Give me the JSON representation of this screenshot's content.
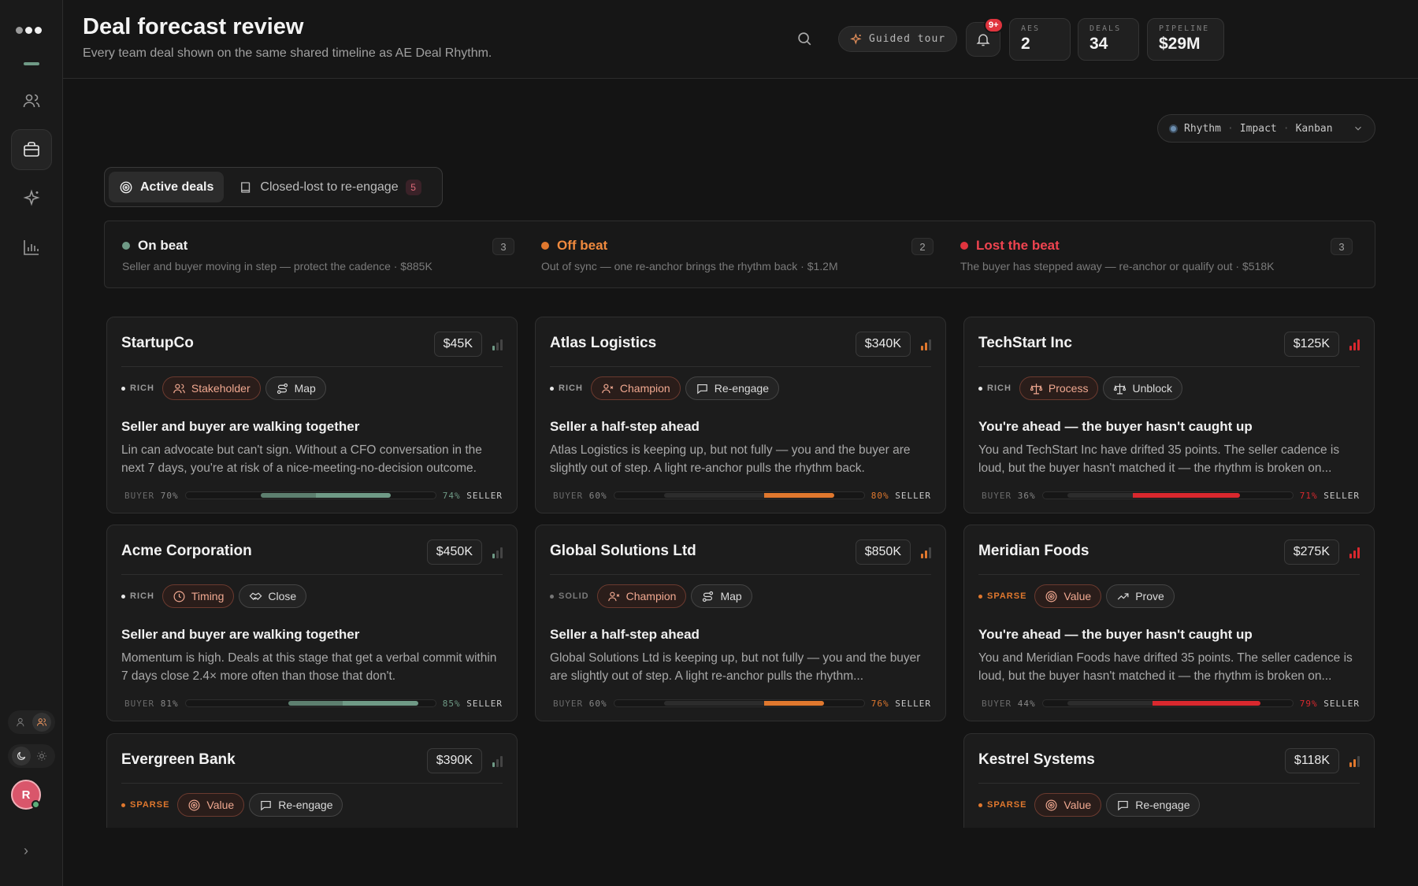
{
  "header": {
    "title": "Deal forecast review",
    "subtitle": "Every team deal shown on the same shared timeline as AE Deal Rhythm.",
    "guided_tour": "Guided tour",
    "notifications_badge": "9+",
    "stats": [
      {
        "label": "AES",
        "value": "2"
      },
      {
        "label": "DEALS",
        "value": "34"
      },
      {
        "label": "PIPELINE",
        "value": "$29M"
      }
    ]
  },
  "sidebar": {
    "avatar_initial": "R",
    "items": [
      {
        "icon": "users-icon",
        "active": false
      },
      {
        "icon": "briefcase-icon",
        "active": true
      },
      {
        "icon": "sparkle-icon",
        "active": false
      },
      {
        "icon": "bar-chart-icon",
        "active": false
      }
    ]
  },
  "view_switch": {
    "options": [
      "Rhythm",
      "Impact",
      "Kanban"
    ],
    "selected": "Rhythm"
  },
  "deal_tabs": {
    "active": "Active deals",
    "closed_lost": "Closed-lost to re-engage",
    "closed_lost_count": "5"
  },
  "beats": [
    {
      "title": "On beat",
      "desc": "Seller and buyer moving in step — protect the cadence · $885K",
      "count": "3",
      "color": "#6f9a86",
      "title_color": "#f0f0f0"
    },
    {
      "title": "Off beat",
      "desc": "Out of sync — one re-anchor brings the rhythm back · $1.2M",
      "count": "2",
      "color": "#e0782e",
      "title_color": "#f08a3e"
    },
    {
      "title": "Lost the beat",
      "desc": "The buyer has stepped away — re-anchor or qualify out · $518K",
      "count": "3",
      "color": "#e0343e",
      "title_color": "#f04450"
    }
  ],
  "colors": {
    "green": "#6f9a86",
    "orange": "#e0782e",
    "red": "#d9282e"
  },
  "cards": [
    {
      "name": "StartupCo",
      "amount": "$45K",
      "richness": "RICH",
      "tag1": "Stakeholder",
      "tag1_icon": "users-icon",
      "tag2": "Map",
      "tag2_icon": "route-icon",
      "headline": "Seller and buyer are walking together",
      "body": "Lin can advocate but can't sign. Without a CFO conversation in the next 7 days, you're at risk of a nice-meeting-no-decision outcome.",
      "buyer_pct": "70%",
      "seller_pct": "74%",
      "buyer": 70,
      "seller": 74,
      "status": "green"
    },
    {
      "name": "Atlas Logistics",
      "amount": "$340K",
      "richness": "RICH",
      "tag1": "Champion",
      "tag1_icon": "user-x-icon",
      "tag2": "Re-engage",
      "tag2_icon": "message-icon",
      "headline": "Seller a half-step ahead",
      "body": "Atlas Logistics is keeping up, but not fully — you and the buyer are slightly out of step. A light re-anchor pulls the rhythm back.",
      "buyer_pct": "60%",
      "seller_pct": "80%",
      "buyer": 60,
      "seller": 80,
      "status": "orange"
    },
    {
      "name": "TechStart Inc",
      "amount": "$125K",
      "richness": "RICH",
      "tag1": "Process",
      "tag1_icon": "scale-icon",
      "tag2": "Unblock",
      "tag2_icon": "scale-icon",
      "headline": "You're ahead — the buyer hasn't caught up",
      "body": "You and TechStart Inc have drifted 35 points. The seller cadence is loud, but the buyer hasn't matched it — the rhythm is broken on...",
      "buyer_pct": "36%",
      "seller_pct": "71%",
      "buyer": 36,
      "seller": 71,
      "status": "red"
    },
    {
      "name": "Acme Corporation",
      "amount": "$450K",
      "richness": "RICH",
      "tag1": "Timing",
      "tag1_icon": "clock-icon",
      "tag2": "Close",
      "tag2_icon": "handshake-icon",
      "headline": "Seller and buyer are walking together",
      "body": "Momentum is high. Deals at this stage that get a verbal commit within 7 days close 2.4× more often than those that don't.",
      "buyer_pct": "81%",
      "seller_pct": "85%",
      "buyer": 81,
      "seller": 85,
      "status": "green"
    },
    {
      "name": "Global Solutions Ltd",
      "amount": "$850K",
      "richness": "SOLID",
      "tag1": "Champion",
      "tag1_icon": "user-x-icon",
      "tag2": "Map",
      "tag2_icon": "route-icon",
      "headline": "Seller a half-step ahead",
      "body": "Global Solutions Ltd is keeping up, but not fully — you and the buyer are slightly out of step. A light re-anchor pulls the rhythm...",
      "buyer_pct": "60%",
      "seller_pct": "76%",
      "buyer": 60,
      "seller": 76,
      "status": "orange"
    },
    {
      "name": "Meridian Foods",
      "amount": "$275K",
      "richness": "SPARSE",
      "tag1": "Value",
      "tag1_icon": "target-icon",
      "tag2": "Prove",
      "tag2_icon": "trend-icon",
      "headline": "You're ahead — the buyer hasn't caught up",
      "body": "You and Meridian Foods have drifted 35 points. The seller cadence is loud, but the buyer hasn't matched it — the rhythm is broken on...",
      "buyer_pct": "44%",
      "seller_pct": "79%",
      "buyer": 44,
      "seller": 79,
      "status": "red"
    },
    {
      "name": "Evergreen Bank",
      "amount": "$390K",
      "richness": "SPARSE",
      "tag1": "Value",
      "tag1_icon": "target-icon",
      "tag2": "Re-engage",
      "tag2_icon": "message-icon",
      "status": "green"
    },
    {
      "name": "Kestrel Systems",
      "amount": "$118K",
      "richness": "SPARSE",
      "tag1": "Value",
      "tag1_icon": "target-icon",
      "tag2": "Re-engage",
      "tag2_icon": "message-icon",
      "status": "orange"
    }
  ]
}
